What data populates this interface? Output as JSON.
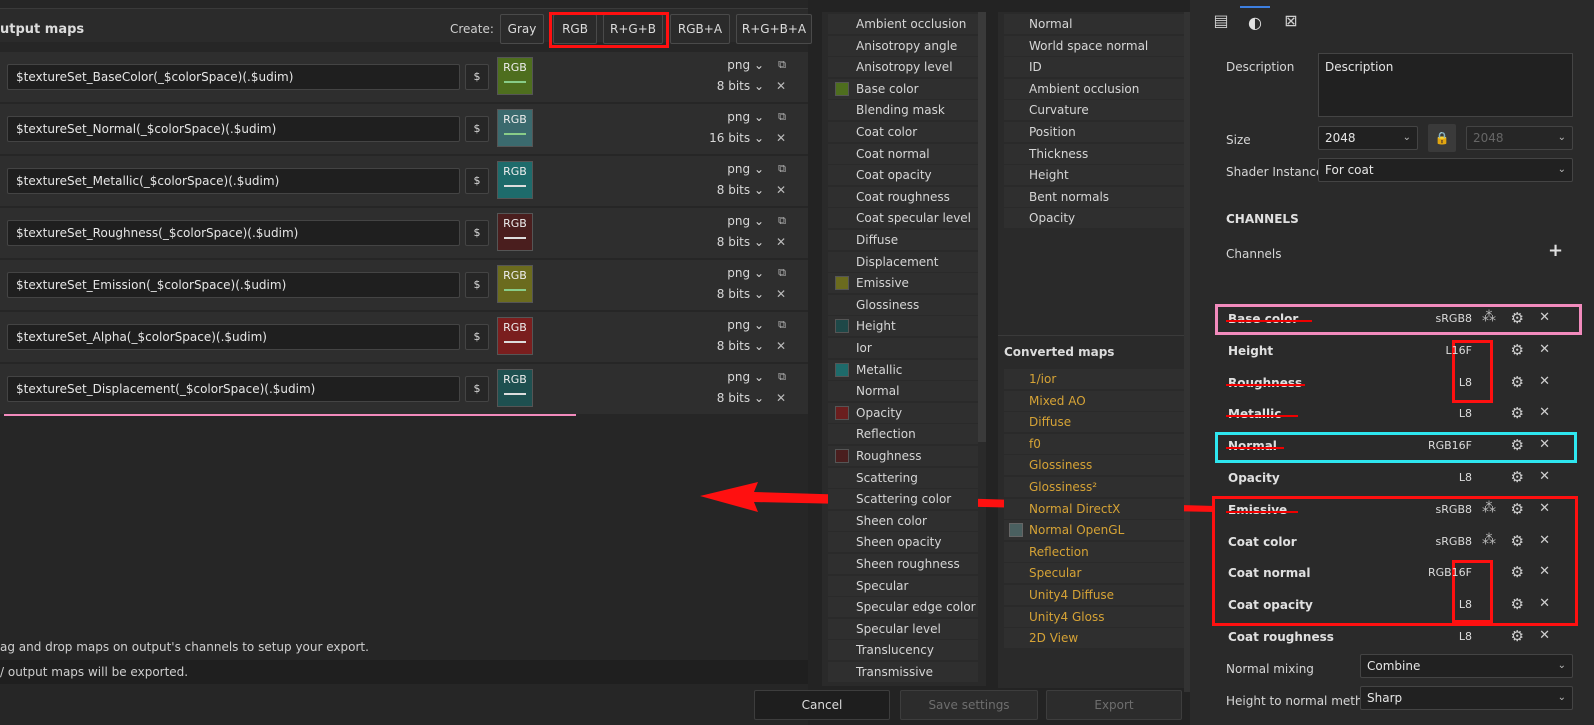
{
  "header": {
    "title": "utput maps",
    "create_label": "Create:",
    "create_buttons": [
      "Gray",
      "RGB",
      "R+G+B",
      "RGB+A",
      "R+G+B+A"
    ]
  },
  "output_maps": [
    {
      "name": "$textureSet_BaseColor(_$colorSpace)(.$udim)",
      "dollar": "$",
      "chip": "RGB",
      "format": "png",
      "bits": "8 bits",
      "chip_color": "#4e6e1e",
      "line_color": "#8c8"
    },
    {
      "name": "$textureSet_Normal(_$colorSpace)(.$udim)",
      "dollar": "$",
      "chip": "RGB",
      "format": "png",
      "bits": "16 bits",
      "chip_color": "#3b6a6e",
      "line_color": "#8c8"
    },
    {
      "name": "$textureSet_Metallic(_$colorSpace)(.$udim)",
      "dollar": "$",
      "chip": "RGB",
      "format": "png",
      "bits": "8 bits",
      "chip_color": "#1e6b6b",
      "line_color": "#ddd"
    },
    {
      "name": "$textureSet_Roughness(_$colorSpace)(.$udim)",
      "dollar": "$",
      "chip": "RGB",
      "format": "png",
      "bits": "8 bits",
      "chip_color": "#4a1e1e",
      "line_color": "#ddd"
    },
    {
      "name": "$textureSet_Emission(_$colorSpace)(.$udim)",
      "dollar": "$",
      "chip": "RGB",
      "format": "png",
      "bits": "8 bits",
      "chip_color": "#6b6b1e",
      "line_color": "#8c8"
    },
    {
      "name": "$textureSet_Alpha(_$colorSpace)(.$udim)",
      "dollar": "$",
      "chip": "RGB",
      "format": "png",
      "bits": "8 bits",
      "chip_color": "#7a1e1e",
      "line_color": "#ddd"
    },
    {
      "name": "$textureSet_Displacement(_$colorSpace)(.$udim)",
      "dollar": "$",
      "chip": "RGB",
      "format": "png",
      "bits": "8 bits",
      "chip_color": "#1e5050",
      "line_color": "#ddd"
    }
  ],
  "hints": {
    "drag": "ag and drop maps on output's channels to setup your export.",
    "export": "/ output maps will be exported."
  },
  "input_maps": [
    {
      "label": "Ambient occlusion",
      "swatch": ""
    },
    {
      "label": "Anisotropy angle",
      "swatch": ""
    },
    {
      "label": "Anisotropy level",
      "swatch": ""
    },
    {
      "label": "Base color",
      "swatch": "#4e6e1e"
    },
    {
      "label": "Blending mask",
      "swatch": ""
    },
    {
      "label": "Coat color",
      "swatch": ""
    },
    {
      "label": "Coat normal",
      "swatch": ""
    },
    {
      "label": "Coat opacity",
      "swatch": ""
    },
    {
      "label": "Coat roughness",
      "swatch": ""
    },
    {
      "label": "Coat specular level",
      "swatch": ""
    },
    {
      "label": "Diffuse",
      "swatch": ""
    },
    {
      "label": "Displacement",
      "swatch": ""
    },
    {
      "label": "Emissive",
      "swatch": "#6b6b1e"
    },
    {
      "label": "Glossiness",
      "swatch": ""
    },
    {
      "label": "Height",
      "swatch": "#1e4848"
    },
    {
      "label": "Ior",
      "swatch": ""
    },
    {
      "label": "Metallic",
      "swatch": "#1e6b6b"
    },
    {
      "label": "Normal",
      "swatch": ""
    },
    {
      "label": "Opacity",
      "swatch": "#6b1e1e"
    },
    {
      "label": "Reflection",
      "swatch": ""
    },
    {
      "label": "Roughness",
      "swatch": "#4a1e1e"
    },
    {
      "label": "Scattering",
      "swatch": ""
    },
    {
      "label": "Scattering color",
      "swatch": ""
    },
    {
      "label": "Sheen color",
      "swatch": ""
    },
    {
      "label": "Sheen opacity",
      "swatch": ""
    },
    {
      "label": "Sheen roughness",
      "swatch": ""
    },
    {
      "label": "Specular",
      "swatch": ""
    },
    {
      "label": "Specular edge color",
      "swatch": ""
    },
    {
      "label": "Specular level",
      "swatch": ""
    },
    {
      "label": "Translucency",
      "swatch": ""
    },
    {
      "label": "Transmissive",
      "swatch": ""
    }
  ],
  "mesh_maps": [
    "Normal",
    "World space normal",
    "ID",
    "Ambient occlusion",
    "Curvature",
    "Position",
    "Thickness",
    "Height",
    "Bent normals",
    "Opacity"
  ],
  "converted": {
    "title": "Converted maps",
    "items": [
      {
        "label": "1/ior",
        "swatch": ""
      },
      {
        "label": "Mixed AO",
        "swatch": ""
      },
      {
        "label": "Diffuse",
        "swatch": ""
      },
      {
        "label": "f0",
        "swatch": ""
      },
      {
        "label": "Glossiness",
        "swatch": ""
      },
      {
        "label": "Glossiness²",
        "swatch": ""
      },
      {
        "label": "Normal DirectX",
        "swatch": ""
      },
      {
        "label": "Normal OpenGL",
        "swatch": "#4a6060"
      },
      {
        "label": "Reflection",
        "swatch": ""
      },
      {
        "label": "Specular",
        "swatch": ""
      },
      {
        "label": "Unity4 Diffuse",
        "swatch": ""
      },
      {
        "label": "Unity4 Gloss",
        "swatch": ""
      },
      {
        "label": "2D View",
        "swatch": ""
      }
    ]
  },
  "props": {
    "description_label": "Description",
    "description_value": "Description",
    "size_label": "Size",
    "size_value": "2048",
    "size_linked_value": "2048",
    "shader_label": "Shader Instance",
    "shader_value": "For coat",
    "channels_section": "CHANNELS",
    "channels_label": "Channels",
    "add_icon": "+",
    "normal_mixing_label": "Normal mixing",
    "normal_mixing_value": "Combine",
    "height_to_normal_label": "Height to normal method",
    "height_to_normal_value": "Sharp"
  },
  "channels": [
    {
      "name": "Base color",
      "format": "sRGB8",
      "blend": true,
      "struck": true
    },
    {
      "name": "Height",
      "format": "L16F",
      "blend": false,
      "struck": false
    },
    {
      "name": "Roughness",
      "format": "L8",
      "blend": false,
      "struck": true
    },
    {
      "name": "Metallic",
      "format": "L8",
      "blend": false,
      "struck": true
    },
    {
      "name": "Normal",
      "format": "RGB16F",
      "blend": false,
      "struck": true
    },
    {
      "name": "Opacity",
      "format": "L8",
      "blend": false,
      "struck": false
    },
    {
      "name": "Emissive",
      "format": "sRGB8",
      "blend": true,
      "struck": true
    },
    {
      "name": "Coat color",
      "format": "sRGB8",
      "blend": true,
      "struck": false
    },
    {
      "name": "Coat normal",
      "format": "RGB16F",
      "blend": false,
      "struck": false
    },
    {
      "name": "Coat opacity",
      "format": "L8",
      "blend": false,
      "struck": false
    },
    {
      "name": "Coat roughness",
      "format": "L8",
      "blend": false,
      "struck": false
    }
  ],
  "footer": {
    "cancel": "Cancel",
    "save": "Save settings",
    "export": "Export"
  },
  "colors": {
    "annotation_red": "#ff1010",
    "annotation_cyan": "#2ee6ef",
    "annotation_pink": "#f28bbd",
    "accent_orange": "#d6a336"
  }
}
